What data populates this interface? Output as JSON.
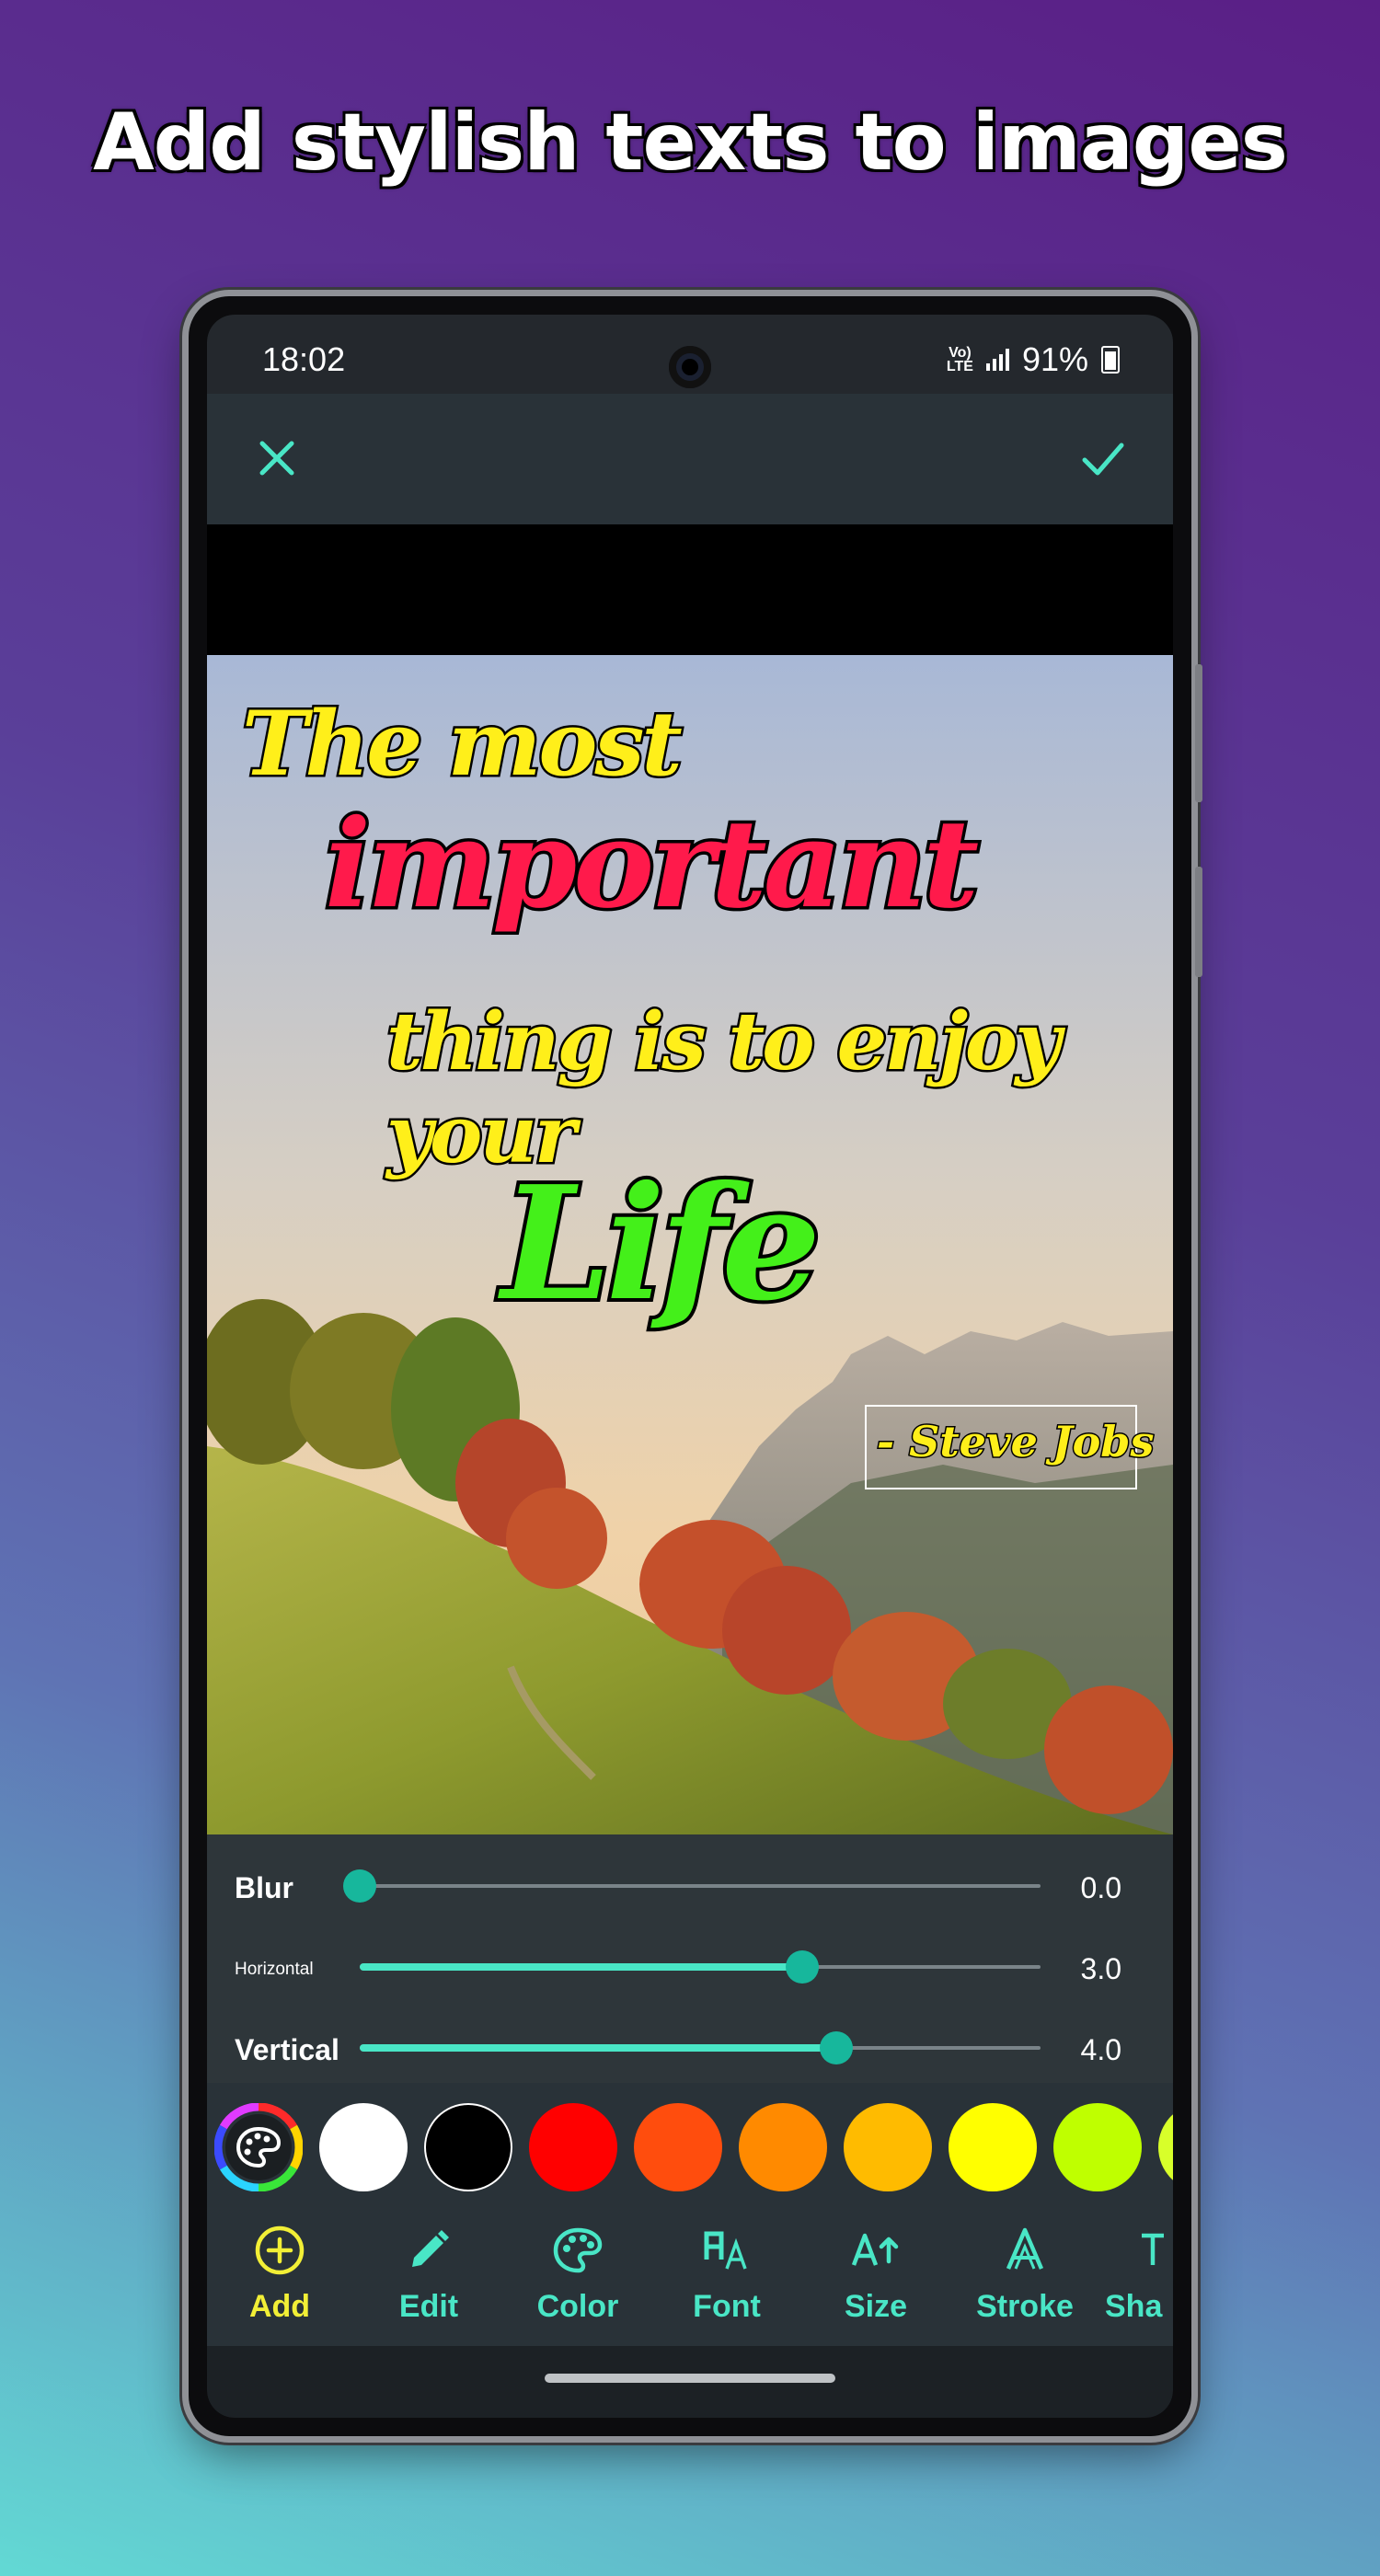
{
  "promo": {
    "title": "Add stylish texts to images"
  },
  "status_bar": {
    "time": "18:02",
    "network": "Vo)) LTE",
    "battery": "91%"
  },
  "app_bar": {
    "close_icon": "close-icon",
    "done_icon": "check-icon"
  },
  "canvas": {
    "quote_lines": [
      "The most",
      "important",
      "thing is to enjoy your",
      "Life"
    ],
    "signature": "- Steve Jobs",
    "colors": {
      "yellow": "#ffef1a",
      "red": "#ff1a4b",
      "green": "#44f01a"
    }
  },
  "shadow_sliders": [
    {
      "label": "Blur",
      "value": "0.0",
      "level": 0.0
    },
    {
      "label": "Horizontal",
      "value": "3.0",
      "level": 0.65
    },
    {
      "label": "Vertical",
      "value": "4.0",
      "level": 0.7
    }
  ],
  "palette": {
    "picker_icon": "palette-icon",
    "swatches": [
      "#ffffff",
      "#000000",
      "#ff0000",
      "#ff4d0d",
      "#ff8a00",
      "#ffbb00",
      "#ffff00",
      "#bfff00"
    ]
  },
  "toolbar": {
    "items": [
      {
        "label": "Add",
        "icon": "add-circle-icon",
        "active": true
      },
      {
        "label": "Edit",
        "icon": "pencil-icon"
      },
      {
        "label": "Color",
        "icon": "palette-icon"
      },
      {
        "label": "Font",
        "icon": "font-icon"
      },
      {
        "label": "Size",
        "icon": "text-size-icon"
      },
      {
        "label": "Stroke",
        "icon": "stroke-icon"
      },
      {
        "label": "Sha",
        "icon": "shadow-icon"
      }
    ],
    "accent": "#49e6c6",
    "active_color": "#f2ef36"
  }
}
